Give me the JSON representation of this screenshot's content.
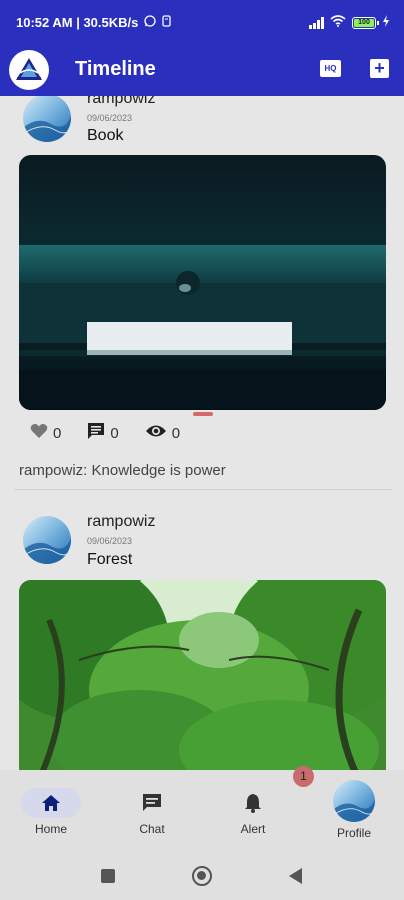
{
  "status_bar": {
    "time_speed": "10:52 AM | 30.5KB/s",
    "battery": "100"
  },
  "app_bar": {
    "title": "Timeline",
    "hq_label": "HQ",
    "add_label": "+"
  },
  "posts": [
    {
      "username": "rampowiz",
      "date": "09/06/2023",
      "title": "Book",
      "likes": "0",
      "comments": "0",
      "views": "0",
      "caption": "rampowiz: Knowledge is power"
    },
    {
      "username": "rampowiz",
      "date": "09/06/2023",
      "title": "Forest"
    }
  ],
  "bottom_nav": {
    "items": [
      {
        "label": "Home",
        "icon": "home-icon"
      },
      {
        "label": "Chat",
        "icon": "chat-icon"
      },
      {
        "label": "Alert",
        "icon": "bell-icon"
      },
      {
        "label": "Profile",
        "icon": "avatar"
      }
    ],
    "alert_badge": "1"
  },
  "colors": {
    "primary": "#2b2fbd",
    "badge": "#c96a6d",
    "home_highlight": "#d6d9ec"
  }
}
